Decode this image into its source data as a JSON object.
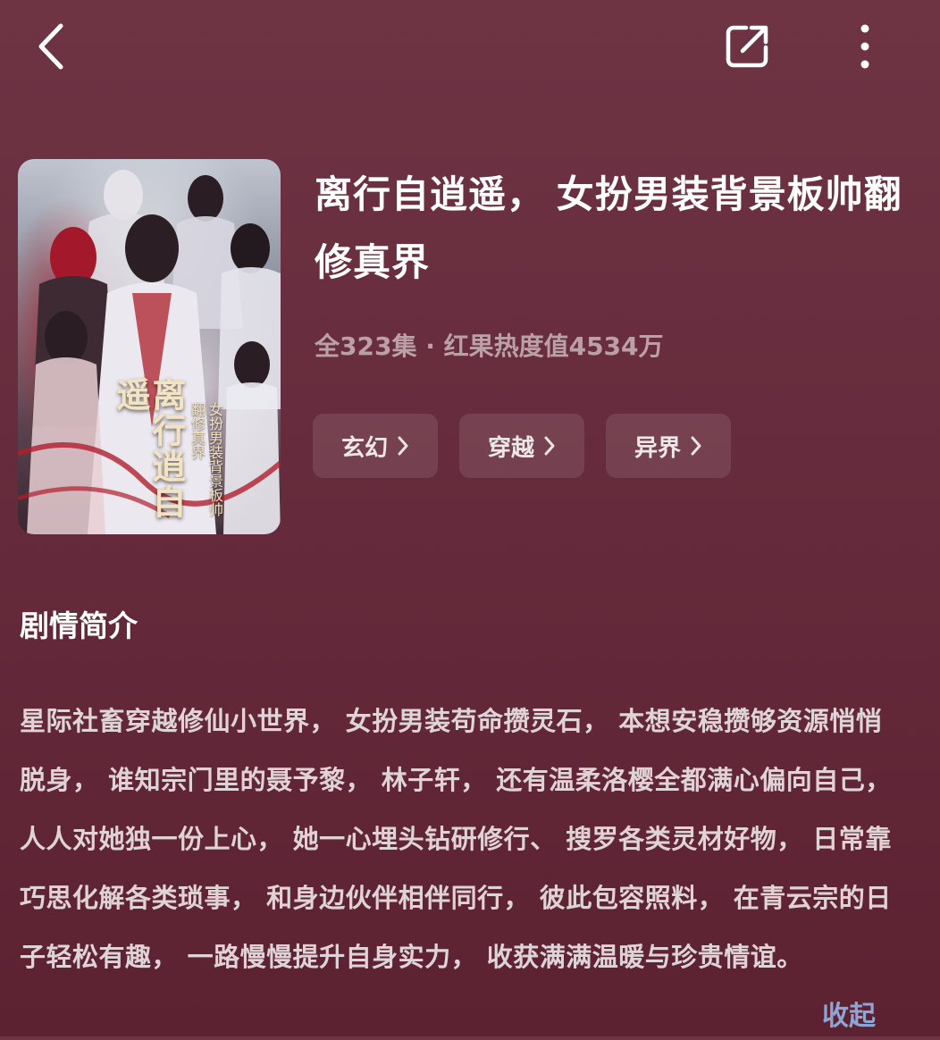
{
  "top_bar": {
    "back_icon": "chevron-left-icon",
    "share_icon": "share-icon",
    "more_icon": "more-vertical-icon"
  },
  "cover": {
    "title_art": "离行逍自遥",
    "subtitle_art": "女扮男装背景板帅翻修真界",
    "badge_icon": "image-gallery-icon"
  },
  "drama": {
    "title": "离行自逍遥， 女扮男装背景板帅翻修真界",
    "meta": "全323集 · 红果热度值4534万",
    "tags": [
      {
        "label": "玄幻"
      },
      {
        "label": "穿越"
      },
      {
        "label": "异界"
      }
    ]
  },
  "synopsis": {
    "heading": "剧情简介",
    "text": "星际社畜穿越修仙小世界， 女扮男装苟命攒灵石， 本想安稳攒够资源悄悄脱身， 谁知宗门里的聂予黎， 林子轩， 还有温柔洛樱全都满心偏向自己， 人人对她独一份上心， 她一心埋头钻研修行、 搜罗各类灵材好物， 日常靠巧思化解各类琐事， 和身边伙伴相伴同行， 彼此包容照料， 在青云宗的日子轻松有趣， 一路慢慢提升自身实力， 收获满满温暖与珍贵情谊。",
    "collapse_label": "收起"
  },
  "colors": {
    "background": "#662c3d",
    "accent_link": "#8fa5d6"
  }
}
